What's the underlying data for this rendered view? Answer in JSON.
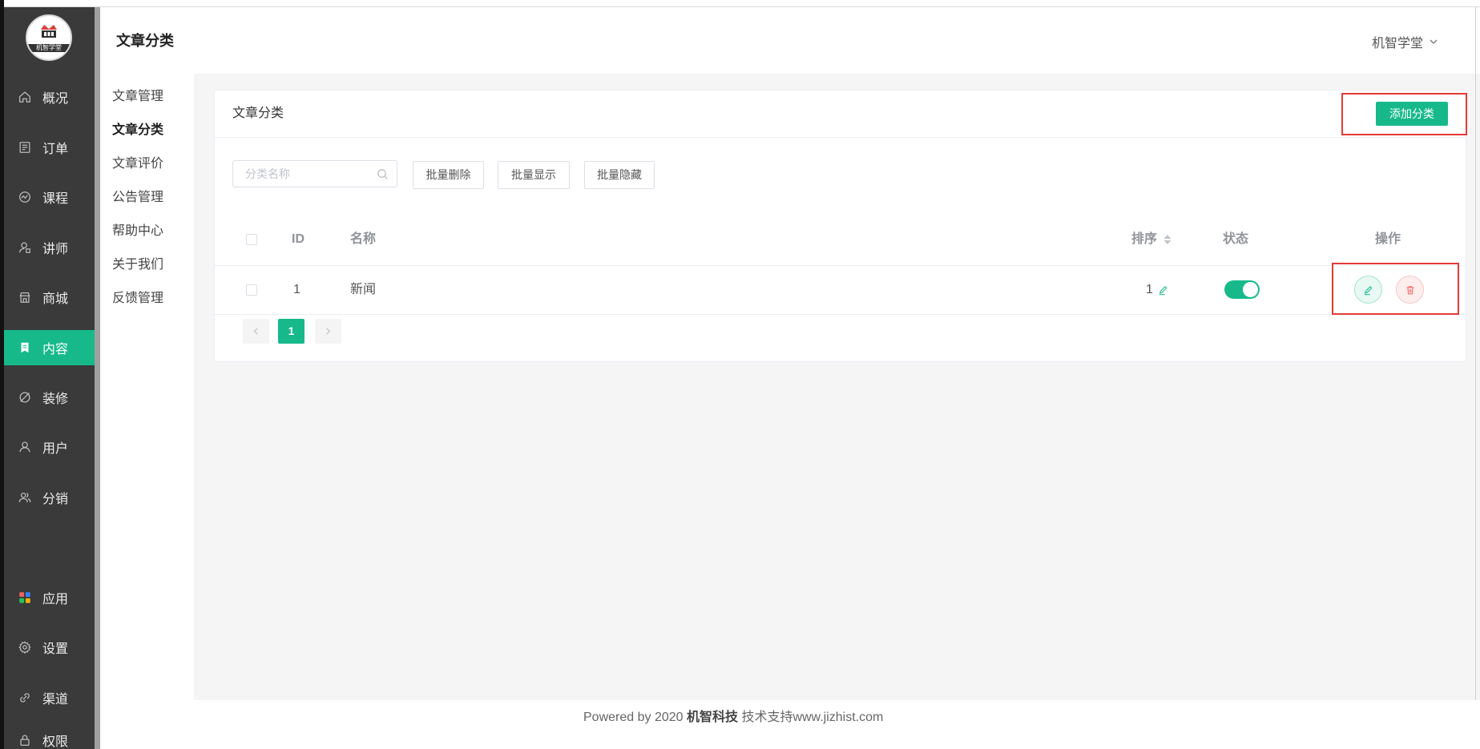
{
  "theme": {
    "accent": "#17b98b",
    "sidebar_bg": "#3a3a3a",
    "danger": "#f56c6c",
    "highlight": "#e53935"
  },
  "sidebar": {
    "logo_text": "机智学堂",
    "items": [
      {
        "label": "概况",
        "icon": "home-icon"
      },
      {
        "label": "订单",
        "icon": "order-icon"
      },
      {
        "label": "课程",
        "icon": "course-icon"
      },
      {
        "label": "讲师",
        "icon": "teacher-icon"
      },
      {
        "label": "商城",
        "icon": "shop-icon"
      },
      {
        "label": "内容",
        "icon": "content-icon",
        "active": true
      },
      {
        "label": "装修",
        "icon": "decorate-icon"
      },
      {
        "label": "用户",
        "icon": "user-icon"
      },
      {
        "label": "分销",
        "icon": "distribution-icon"
      },
      {
        "label": "应用",
        "icon": "apps-icon"
      },
      {
        "label": "设置",
        "icon": "settings-icon"
      },
      {
        "label": "渠道",
        "icon": "channel-icon"
      },
      {
        "label": "权限",
        "icon": "lock-icon"
      }
    ]
  },
  "header": {
    "title": "文章分类",
    "user": "机智学堂"
  },
  "subnav": {
    "items": [
      {
        "label": "文章管理"
      },
      {
        "label": "文章分类",
        "active": true
      },
      {
        "label": "文章评价"
      },
      {
        "label": "公告管理"
      },
      {
        "label": "帮助中心"
      },
      {
        "label": "关于我们"
      },
      {
        "label": "反馈管理"
      }
    ]
  },
  "card": {
    "title": "文章分类",
    "add_label": "添加分类"
  },
  "toolbar": {
    "search_placeholder": "分类名称",
    "search_value": "",
    "batch_delete": "批量删除",
    "batch_show": "批量显示",
    "batch_hide": "批量隐藏"
  },
  "table": {
    "columns": {
      "id": "ID",
      "name": "名称",
      "sort": "排序",
      "status": "状态",
      "actions": "操作"
    },
    "rows": [
      {
        "id": "1",
        "name": "新闻",
        "sort": "1",
        "status_on": true
      }
    ]
  },
  "pagination": {
    "current": "1"
  },
  "footer": {
    "prefix": "Powered by 2020 ",
    "brand": "机智科技",
    "suffix": " 技术支持www.jizhist.com"
  }
}
